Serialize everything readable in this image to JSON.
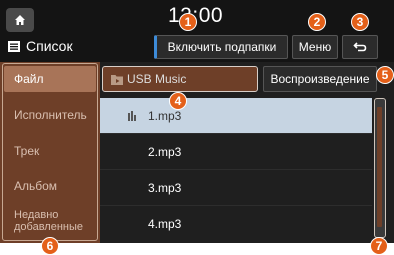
{
  "header": {
    "time": "12:00",
    "title": "Список",
    "btn_subfolders": "Включить подпапки",
    "btn_menu": "Меню",
    "home_icon": "home-icon",
    "back_icon": "back-arrow-icon"
  },
  "sidebar": {
    "items": [
      {
        "label": "Файл",
        "active": true
      },
      {
        "label": "Исполнитель"
      },
      {
        "label": "Трек"
      },
      {
        "label": "Альбом"
      },
      {
        "label": "Недавно добавленные"
      }
    ]
  },
  "main": {
    "folder": "USB Music",
    "btn_play": "Воспроизведение",
    "files": [
      {
        "name": "1.mp3",
        "playing": true
      },
      {
        "name": "2.mp3"
      },
      {
        "name": "3.mp3"
      },
      {
        "name": "4.mp3"
      }
    ]
  },
  "callouts": [
    "1",
    "2",
    "3",
    "4",
    "5",
    "6",
    "7"
  ],
  "colors": {
    "accent": "#e46019",
    "sidebar_bg": "#6e3f28",
    "selected_row": "#c6d4e2"
  }
}
